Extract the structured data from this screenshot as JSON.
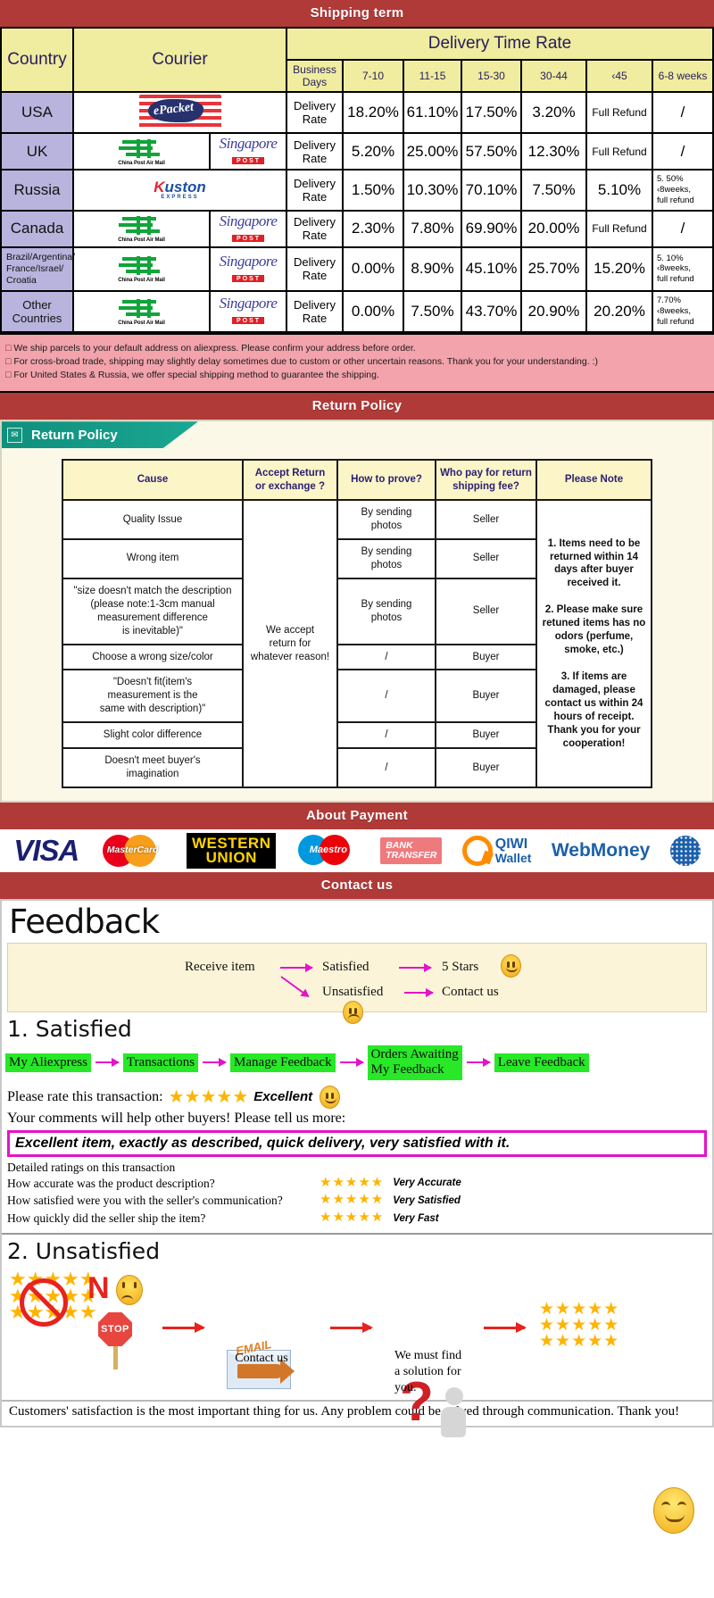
{
  "banners": {
    "shipping": "Shipping term",
    "return": "Return Policy",
    "payment": "About Payment",
    "contact": "Contact us"
  },
  "shipping": {
    "headers": {
      "country": "Country",
      "courier": "Courier",
      "delivery_time_rate": "Delivery Time Rate",
      "business_days": "Business Days",
      "ranges": [
        "7-10",
        "11-15",
        "15-30",
        "30-44",
        "‹45",
        "6-8 weeks"
      ]
    },
    "rate_label": "Delivery Rate",
    "rows": [
      {
        "country": "USA",
        "couriers": [
          "epacket-logo"
        ],
        "values": [
          "18.20%",
          "61.10%",
          "17.50%",
          "3.20%",
          "Full Refund",
          "/"
        ]
      },
      {
        "country": "UK",
        "couriers": [
          "china-post-air-mail-logo",
          "singapore-post-logo"
        ],
        "values": [
          "5.20%",
          "25.00%",
          "57.50%",
          "12.30%",
          "Full Refund",
          "/"
        ]
      },
      {
        "country": "Russia",
        "couriers": [
          "kuston-express-logo"
        ],
        "values": [
          "1.50%",
          "10.30%",
          "70.10%",
          "7.50%",
          "5.10%",
          "5. 50%\n‹8weeks,\nfull refund"
        ]
      },
      {
        "country": "Canada",
        "couriers": [
          "china-post-air-mail-logo",
          "singapore-post-logo"
        ],
        "values": [
          "2.30%",
          "7.80%",
          "69.90%",
          "20.00%",
          "Full Refund",
          "/"
        ]
      },
      {
        "country": "Brazil/Argentina/\nFrance/Israel/\nCroatia",
        "couriers": [
          "china-post-air-mail-logo",
          "singapore-post-logo"
        ],
        "values": [
          "0.00%",
          "8.90%",
          "45.10%",
          "25.70%",
          "15.20%",
          "5. 10%\n‹8weeks,\nfull refund"
        ]
      },
      {
        "country": "Other Countries",
        "couriers": [
          "china-post-air-mail-logo",
          "singapore-post-logo"
        ],
        "values": [
          "0.00%",
          "7.50%",
          "43.70%",
          "20.90%",
          "20.20%",
          "7.70%\n‹8weeks,\nfull refund"
        ]
      }
    ],
    "notes": [
      "We ship parcels to your default address on aliexpress. Please confirm your address before order.",
      "For cross-broad trade, shipping may slightly delay sometimes due to custom or other uncertain reasons. Thank you for your understanding. :)",
      "For United States & Russia, we offer special shipping method to guarantee the shipping."
    ]
  },
  "return_policy": {
    "tab_label": "Return Policy",
    "columns": [
      "Cause",
      "Accept Return\nor exchange ?",
      "How to prove?",
      "Who pay for return\nshipping fee?",
      "Please Note"
    ],
    "accept_text": "We accept\nreturn for\nwhatever reason!",
    "rows": [
      {
        "cause": "Quality Issue",
        "prove": "By sending\nphotos",
        "pay": "Seller"
      },
      {
        "cause": "Wrong item",
        "prove": "By sending\nphotos",
        "pay": "Seller"
      },
      {
        "cause": "\"size doesn't match the description\n(please note:1-3cm manual\nmeasurement difference\nis inevitable)\"",
        "prove": "By sending\nphotos",
        "pay": "Seller"
      },
      {
        "cause": "Choose a wrong size/color",
        "prove": "/",
        "pay": "Buyer"
      },
      {
        "cause": "\"Doesn't fit(item's\nmeasurement is the\nsame with description)\"",
        "prove": "/",
        "pay": "Buyer"
      },
      {
        "cause": "Slight color difference",
        "prove": "/",
        "pay": "Buyer"
      },
      {
        "cause": "Doesn't meet buyer's\nimagination",
        "prove": "/",
        "pay": "Buyer"
      }
    ],
    "note": "1. Items need to be returned within 14 days after buyer received it.\n\n2. Please make sure retuned items has no odors (perfume, smoke, etc.)\n\n3. If items are damaged, please contact us within 24 hours of receipt.\nThank you for your cooperation!"
  },
  "payment": {
    "methods": [
      {
        "id": "visa-logo",
        "label": "VISA"
      },
      {
        "id": "mastercard-logo",
        "label": "MasterCard"
      },
      {
        "id": "western-union-logo",
        "label": "WESTERN UNION",
        "line1": "WESTERN",
        "line2": "UNION"
      },
      {
        "id": "maestro-logo",
        "label": "Maestro"
      },
      {
        "id": "bank-transfer-logo",
        "label": "BANK TRANSFER",
        "line1": "BANK",
        "line2": "TRANSFER"
      },
      {
        "id": "qiwi-wallet-logo",
        "label": "QIWI Wallet",
        "line1": "QIWI",
        "line2": "Wallet"
      },
      {
        "id": "webmoney-logo",
        "label": "WebMoney"
      }
    ]
  },
  "feedback": {
    "title": "Feedback",
    "flow": {
      "receive": "Receive item",
      "satisfied": "Satisfied",
      "five_stars": "5 Stars",
      "unsatisfied": "Unsatisfied",
      "contact": "Contact us"
    },
    "satisfied": {
      "heading": "1. Satisfied",
      "steps": [
        "My Aliexpress",
        "Transactions",
        "Manage Feedback",
        "Orders Awaiting\nMy Feedback",
        "Leave Feedback"
      ],
      "rate_prompt": "Please rate this transaction:",
      "stars": "★★★★★",
      "rating_word": "Excellent",
      "comment_prompt": "Your comments will help other buyers! Please tell us more:",
      "comment_text": "Excellent item, exactly as described, quick delivery, very satisfied with it.",
      "detail_heading": "Detailed ratings on this transaction",
      "details": [
        {
          "question": "How accurate was the product description?",
          "stars": "★★★★★",
          "label": "Very Accurate"
        },
        {
          "question": "How satisfied were you with the seller's communication?",
          "stars": "★★★★★",
          "label": "Very Satisfied"
        },
        {
          "question": "How quickly did the seller ship the item?",
          "stars": "★★★★★",
          "label": "Very Fast"
        }
      ]
    },
    "unsatisfied": {
      "heading": "2. Unsatisfied",
      "no_label": "N",
      "stop_label": "STOP",
      "email_label": "EMAIL",
      "contact_caption": "Contact us",
      "solution_caption": "We must find\na solution for\nyou.",
      "closing": "Customers' satisfaction is the most important thing for us. Any problem could be solved through communication. Thank you!"
    }
  },
  "colors": {
    "banner_red": "#b03a38",
    "header_yellow": "#f0eca0",
    "country_purple": "#b8b4dd",
    "note_pink": "#f2a3ac",
    "tab_teal": "#12957f",
    "chip_green": "#28e828",
    "magenta": "#e413c9",
    "star_gold": "#ffb400"
  }
}
